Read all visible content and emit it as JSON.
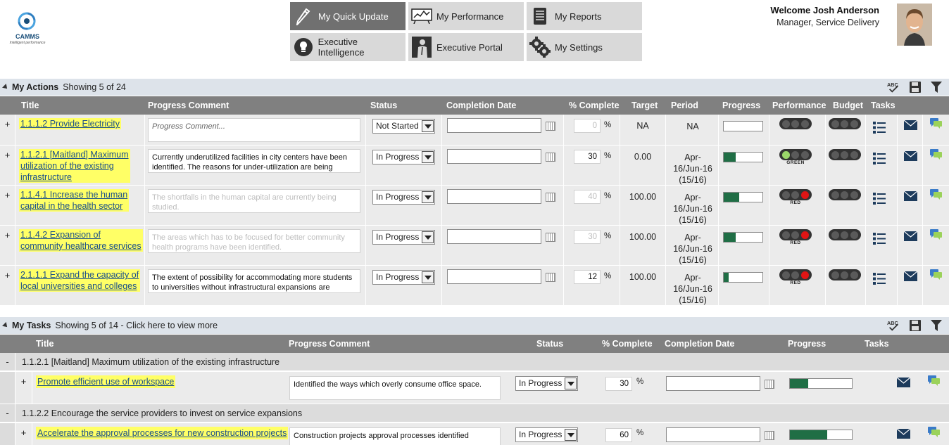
{
  "logo": {
    "name": "CAMMS",
    "tagline": "Intelligent performance"
  },
  "nav": [
    {
      "label": "My Quick Update",
      "icon": "pencil-icon",
      "active": true
    },
    {
      "label": "My Performance",
      "icon": "performance-chart-icon",
      "active": false
    },
    {
      "label": "My Reports",
      "icon": "reports-icon",
      "active": false
    },
    {
      "label": "Executive Intelligence",
      "icon": "lightbulb-icon",
      "active": false
    },
    {
      "label": "Executive Portal",
      "icon": "executive-icon",
      "active": false
    },
    {
      "label": "My Settings",
      "icon": "gears-icon",
      "active": false
    }
  ],
  "user": {
    "welcome": "Welcome Josh Anderson",
    "role": "Manager, Service Delivery"
  },
  "actions": {
    "title": "My Actions",
    "count": "Showing 5 of 24",
    "columns": [
      "Title",
      "Progress Comment",
      "Status",
      "Completion Date",
      "% Complete",
      "Target",
      "Period",
      "Progress",
      "Performance",
      "Budget",
      "Tasks"
    ],
    "rows": [
      {
        "title": "1.1.1.2 Provide Electricity",
        "title_lines": [
          "1.1.1.2 Provide Electricity"
        ],
        "comment": "Progress Comment...",
        "comment_style": "placeholder",
        "status": "Not Started",
        "completion_date": "",
        "pct": "0",
        "pct_dim": true,
        "target": "NA",
        "period": [
          "NA"
        ],
        "progress": 0,
        "performance": "none",
        "performance_label": "",
        "budget": "none"
      },
      {
        "title": "1.1.2.1 [Maitland] Maximum utilization of the existing infrastructure",
        "title_lines": [
          "1.1.2.1 [Maitland] Maximum",
          "utilization of the existing",
          "infrastructure"
        ],
        "comment": "Currently underutilized facilities in city centers have been identified. The reasons for under-utilization  are being",
        "comment_style": "normal",
        "status": "In Progress",
        "completion_date": "",
        "pct": "30",
        "pct_dim": false,
        "target": "0.00",
        "period": [
          "Apr-",
          "16/Jun-16",
          "(15/16)"
        ],
        "progress": 30,
        "performance": "green",
        "performance_label": "GREEN",
        "budget": "none"
      },
      {
        "title": "1.1.4.1 Increase the human capital in the health sector",
        "title_lines": [
          "1.1.4.1 Increase the human",
          "capital in the health sector"
        ],
        "comment": "The shortfalls in the human capital are currently being studied.",
        "comment_style": "dim",
        "status": "In Progress",
        "completion_date": "",
        "pct": "40",
        "pct_dim": true,
        "target": "100.00",
        "period": [
          "Apr-",
          "16/Jun-16",
          "(15/16)"
        ],
        "progress": 40,
        "performance": "red",
        "performance_label": "RED",
        "budget": "none"
      },
      {
        "title": "1.1.4.2 Expansion of community healthcare services",
        "title_lines": [
          "1.1.4.2 Expansion of",
          "community healthcare services"
        ],
        "comment": "The areas which has to be focused for better community health programs have been identified.",
        "comment_style": "dim",
        "status": "In Progress",
        "completion_date": "",
        "pct": "30",
        "pct_dim": true,
        "target": "100.00",
        "period": [
          "Apr-",
          "16/Jun-16",
          "(15/16)"
        ],
        "progress": 30,
        "performance": "red",
        "performance_label": "RED",
        "budget": "none"
      },
      {
        "title": "2.1.1.1 Expand the capacity of local universities and colleges",
        "title_lines": [
          "2.1.1.1 Expand the capacity of",
          "local universities and colleges"
        ],
        "comment": "The extent of possibility for accommodating more students to universities without infrastructural expansions are",
        "comment_style": "normal",
        "status": "In Progress",
        "completion_date": "",
        "pct": "12",
        "pct_dim": false,
        "target": "100.00",
        "period": [
          "Apr-",
          "16/Jun-16",
          "(15/16)"
        ],
        "progress": 12,
        "performance": "red",
        "performance_label": "RED",
        "budget": "none"
      }
    ]
  },
  "tasks": {
    "title": "My Tasks",
    "count": "Showing 5 of 14 - Click here to view more",
    "columns": [
      "Title",
      "Progress Comment",
      "Status",
      "% Complete",
      "Completion Date",
      "Progress",
      "Tasks"
    ],
    "groups": [
      {
        "label": "1.1.2.1 [Maitland] Maximum utilization of the existing infrastructure",
        "rows": [
          {
            "title": "Promote efficient use of workspace",
            "comment": "Identified the ways which overly consume office space.",
            "status": "In Progress",
            "pct": "30",
            "completion_date": "",
            "progress": 30
          }
        ]
      },
      {
        "label": "1.1.2.2 Encourage the service providers to invest on service expansions",
        "rows": [
          {
            "title": "Accelerate the approval processes for new construction projects",
            "comment": "Construction projects approval processes identified",
            "status": "In Progress",
            "pct": "60",
            "completion_date": "",
            "progress": 60
          }
        ]
      }
    ]
  },
  "pct_sign": "%",
  "colors": {
    "progress_fill": "#1f6e45",
    "active_nav": "#707070",
    "nav": "#d9d9d9",
    "grid_header": "#808080",
    "highlight": "#ffff66",
    "link": "#1a4f8a"
  }
}
